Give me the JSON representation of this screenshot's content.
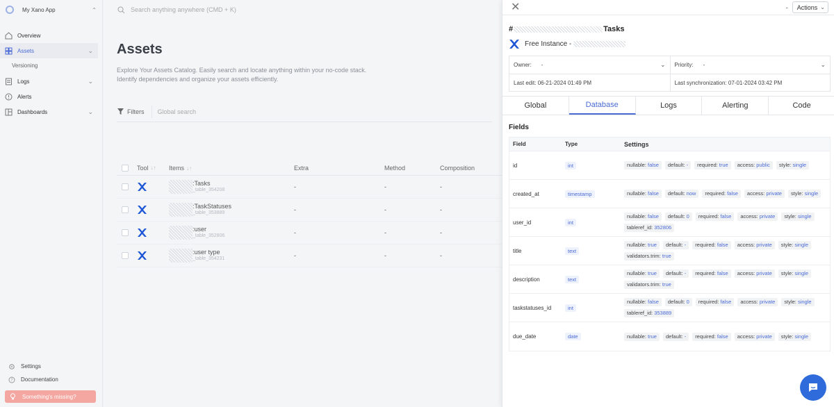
{
  "app": {
    "name": "My Xano App"
  },
  "search": {
    "placeholder": "Search anything anywhere (CMD + K)"
  },
  "sidebar": {
    "items": [
      {
        "label": "Overview",
        "icon": "home-icon"
      },
      {
        "label": "Assets",
        "icon": "grid-icon",
        "active": true
      },
      {
        "label": "Versioning",
        "sub": true
      },
      {
        "label": "Logs",
        "icon": "logs-icon"
      },
      {
        "label": "Alerts",
        "icon": "alert-icon"
      },
      {
        "label": "Dashboards",
        "icon": "dashboard-icon"
      }
    ],
    "bottom": {
      "settings": "Settings",
      "documentation": "Documentation",
      "missing": "Something's missing?"
    }
  },
  "main": {
    "title": "Assets",
    "description": "Explore Your Assets Catalog. Easily search and locate anything within your no-code stack. Identify dependencies and organize your assets efficiently.",
    "filters_label": "Filters",
    "global_search_placeholder": "Global search",
    "columns": {
      "tool": "Tool",
      "items": "Items",
      "extra": "Extra",
      "method": "Method",
      "composition": "Composition"
    },
    "rows": [
      {
        "name": ":Tasks",
        "sub": "_table_354208",
        "extra": "-",
        "method": "-",
        "composition": "-"
      },
      {
        "name": ":TaskStatuses",
        "sub": "_table_353889",
        "extra": "-",
        "method": "-",
        "composition": "-"
      },
      {
        "name": ":user",
        "sub": "_table_352806",
        "extra": "-",
        "method": "-",
        "composition": "-"
      },
      {
        "name": ":user type",
        "sub": "_table_354231",
        "extra": "-",
        "method": "-",
        "composition": "-"
      }
    ]
  },
  "panel": {
    "dash": "-",
    "actions_label": "Actions",
    "title_prefix": "#",
    "title_suffix": "Tasks",
    "instance": "Free Instance -",
    "owner_label": "Owner:",
    "owner_value": "-",
    "priority_label": "Priority:",
    "priority_value": "-",
    "last_edit": "Last edit: 06-21-2024 01:49 PM",
    "last_sync": "Last synchronization: 07-01-2024 03:42 PM",
    "tabs": [
      "Global",
      "Database",
      "Logs",
      "Alerting",
      "Code"
    ],
    "active_tab": 1,
    "fields_heading": "Fields",
    "field_columns": {
      "field": "Field",
      "type": "Type",
      "settings": "Settings"
    },
    "fields": [
      {
        "name": "id",
        "type": "int",
        "settings": [
          [
            "nullable:",
            "false"
          ],
          [
            "default:",
            "-"
          ],
          [
            "required:",
            "true"
          ],
          [
            "access:",
            "public"
          ],
          [
            "style:",
            "single"
          ]
        ]
      },
      {
        "name": "created_at",
        "type": "timestamp",
        "settings": [
          [
            "nullable:",
            "false"
          ],
          [
            "default:",
            "now"
          ],
          [
            "required:",
            "false"
          ],
          [
            "access:",
            "private"
          ],
          [
            "style:",
            "single"
          ]
        ]
      },
      {
        "name": "user_id",
        "type": "int",
        "settings": [
          [
            "nullable:",
            "false"
          ],
          [
            "default:",
            "0"
          ],
          [
            "required:",
            "false"
          ],
          [
            "access:",
            "private"
          ],
          [
            "style:",
            "single"
          ],
          [
            "tableref_id:",
            "352806"
          ]
        ]
      },
      {
        "name": "title",
        "type": "text",
        "settings": [
          [
            "nullable:",
            "true"
          ],
          [
            "default:",
            "-"
          ],
          [
            "required:",
            "false"
          ],
          [
            "access:",
            "private"
          ],
          [
            "style:",
            "single"
          ],
          [
            "validators.trim:",
            "true"
          ]
        ]
      },
      {
        "name": "description",
        "type": "text",
        "settings": [
          [
            "nullable:",
            "true"
          ],
          [
            "default:",
            "-"
          ],
          [
            "required:",
            "false"
          ],
          [
            "access:",
            "private"
          ],
          [
            "style:",
            "single"
          ],
          [
            "validators.trim:",
            "true"
          ]
        ]
      },
      {
        "name": "taskstatuses_id",
        "type": "int",
        "settings": [
          [
            "nullable:",
            "false"
          ],
          [
            "default:",
            "0"
          ],
          [
            "required:",
            "false"
          ],
          [
            "access:",
            "private"
          ],
          [
            "style:",
            "single"
          ],
          [
            "tableref_id:",
            "353889"
          ]
        ]
      },
      {
        "name": "due_date",
        "type": "date",
        "settings": [
          [
            "nullable:",
            "true"
          ],
          [
            "default:",
            "-"
          ],
          [
            "required:",
            "false"
          ],
          [
            "access:",
            "private"
          ],
          [
            "style:",
            "single"
          ]
        ]
      }
    ]
  },
  "colors": {
    "accent": "#4a6bd6",
    "missing": "#f4a6a0",
    "fab": "#2f6bdb"
  }
}
